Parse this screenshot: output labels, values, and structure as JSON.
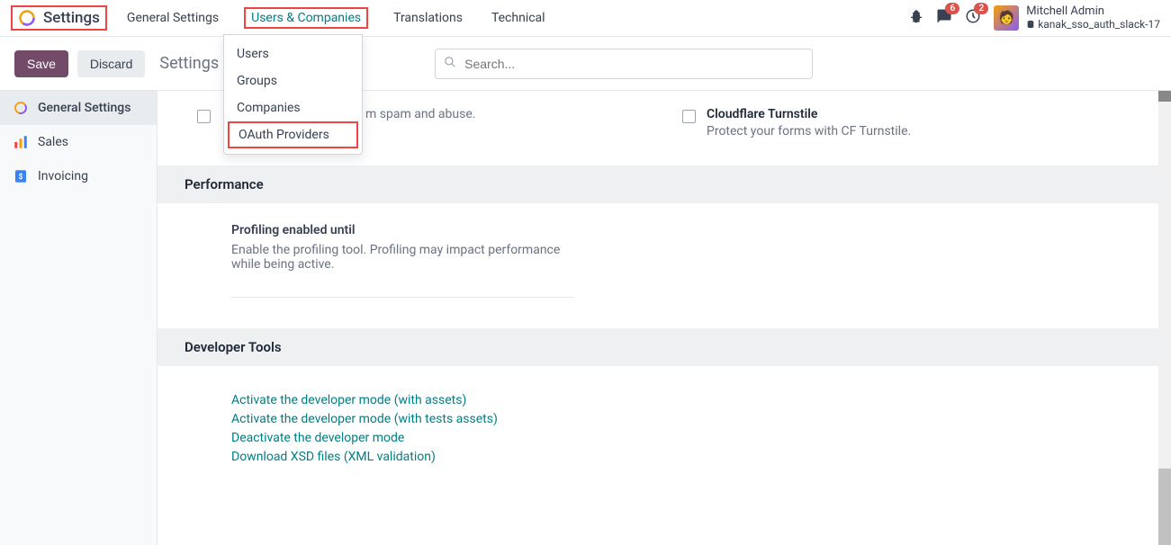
{
  "app": {
    "title": "Settings"
  },
  "top_menu": {
    "items": [
      "General Settings",
      "Users & Companies",
      "Translations",
      "Technical"
    ]
  },
  "dropdown": {
    "items": [
      "Users",
      "Groups",
      "Companies",
      "OAuth Providers"
    ]
  },
  "header_right": {
    "msg_badge": "6",
    "activity_badge": "2",
    "user_name": "Mitchell Admin",
    "db_name": "kanak_sso_auth_slack-17"
  },
  "actions": {
    "save": "Save",
    "discard": "Discard",
    "page_title": "Settings"
  },
  "search": {
    "placeholder": "Search..."
  },
  "sidebar": {
    "items": [
      {
        "label": "General Settings"
      },
      {
        "label": "Sales"
      },
      {
        "label": "Invoicing"
      }
    ]
  },
  "settings_row": {
    "left": {
      "desc_fragment": "m spam and abuse."
    },
    "right": {
      "title": "Cloudflare Turnstile",
      "desc": "Protect your forms with CF Turnstile."
    }
  },
  "sections": {
    "performance": {
      "header": "Performance",
      "title": "Profiling enabled until",
      "desc": "Enable the profiling tool. Profiling may impact performance while being active."
    },
    "devtools": {
      "header": "Developer Tools",
      "links": [
        "Activate the developer mode (with assets)",
        "Activate the developer mode (with tests assets)",
        "Deactivate the developer mode",
        "Download XSD files (XML validation)"
      ]
    }
  }
}
